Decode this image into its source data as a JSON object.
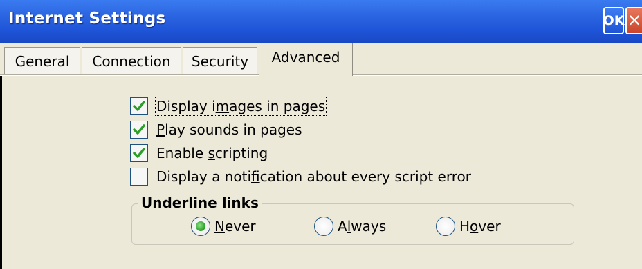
{
  "window": {
    "title": "Internet Settings",
    "ok_label": "OK",
    "close_label": "✕"
  },
  "tabs": [
    {
      "label": "General"
    },
    {
      "label": "Connection"
    },
    {
      "label": "Security"
    },
    {
      "label": "Advanced",
      "selected": true
    }
  ],
  "checkboxes": [
    {
      "label_pre": "Display i",
      "label_u": "m",
      "label_post": "ages in pages",
      "checked": true
    },
    {
      "label_pre": "",
      "label_u": "P",
      "label_post": "lay sounds in pages",
      "checked": true
    },
    {
      "label_pre": "Enable ",
      "label_u": "s",
      "label_post": "cripting",
      "checked": true
    },
    {
      "label_pre": "Display a noti",
      "label_u": "f",
      "label_post": "ication about every script error",
      "checked": false
    }
  ],
  "underline_links": {
    "title": "Underline links",
    "options": [
      {
        "label_pre": "",
        "label_u": "N",
        "label_post": "ever",
        "selected": true
      },
      {
        "label_pre": "A",
        "label_u": "l",
        "label_post": "ways",
        "selected": false
      },
      {
        "label_pre": "H",
        "label_u": "o",
        "label_post": "ver",
        "selected": false
      }
    ]
  },
  "colors": {
    "titlebar": "#1f55d8",
    "check_green": "#2e9e2a",
    "radio_green": "#36a82f",
    "face": "#ece9d8"
  }
}
